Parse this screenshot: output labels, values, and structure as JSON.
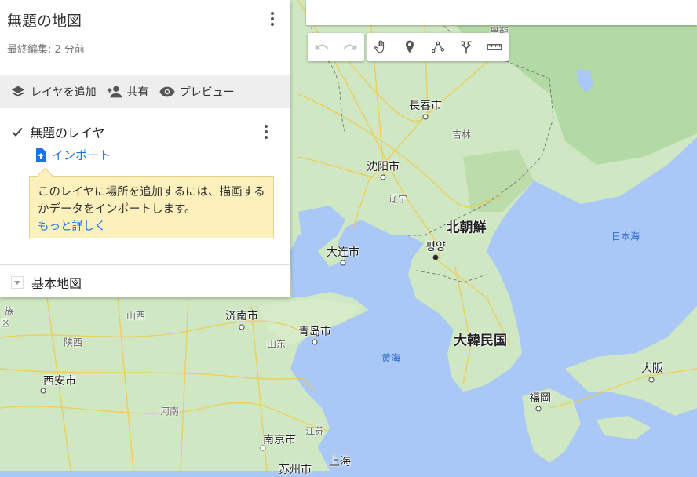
{
  "panel": {
    "title": "無題の地図",
    "subtitle": "最終編集: 2 分前",
    "actions": {
      "add_layer": "レイヤを追加",
      "share": "共有",
      "preview": "プレビュー"
    },
    "layer": {
      "name": "無題のレイヤ",
      "checked": true,
      "import_label": "インポート",
      "tip_text": "このレイヤに場所を追加するには、描画するかデータをインポートします。",
      "tip_link": "もっと詳しく"
    },
    "basemap_label": "基本地図"
  },
  "toolbar": {
    "icons": [
      "undo-icon",
      "redo-icon",
      "hand-icon",
      "marker-icon",
      "draw-line-icon",
      "directions-icon",
      "ruler-icon"
    ]
  },
  "colors": {
    "accent": "#1a73e8",
    "tooltip_bg": "#fcf0bc",
    "water": "#a9c8f5",
    "land": "#cfe8c3"
  },
  "map": {
    "labels": {
      "changchun": "長春市",
      "jilin": "吉林",
      "shenyang": "沈阳市",
      "liaoning": "辽宁",
      "dalian": "大连市",
      "north_korea": "北朝鮮",
      "pyongyang": "평양",
      "sea_of_japan": "日本海",
      "south_korea": "大韓民国",
      "yellow_sea": "黄海",
      "fukuoka": "福岡",
      "osaka": "大阪",
      "jinan": "济南市",
      "qingdao": "青岛市",
      "shandong": "山东",
      "shanxi": "山西",
      "shaanxi": "陕西",
      "xian": "西安市",
      "henan": "河南",
      "nanjing": "南京市",
      "jiangsu": "江苏",
      "shanghai": "上海",
      "suzhou": "苏州市",
      "edge_zu": "族",
      "edge_qu": "区",
      "edge_heilongjiang": "黑龍"
    }
  }
}
